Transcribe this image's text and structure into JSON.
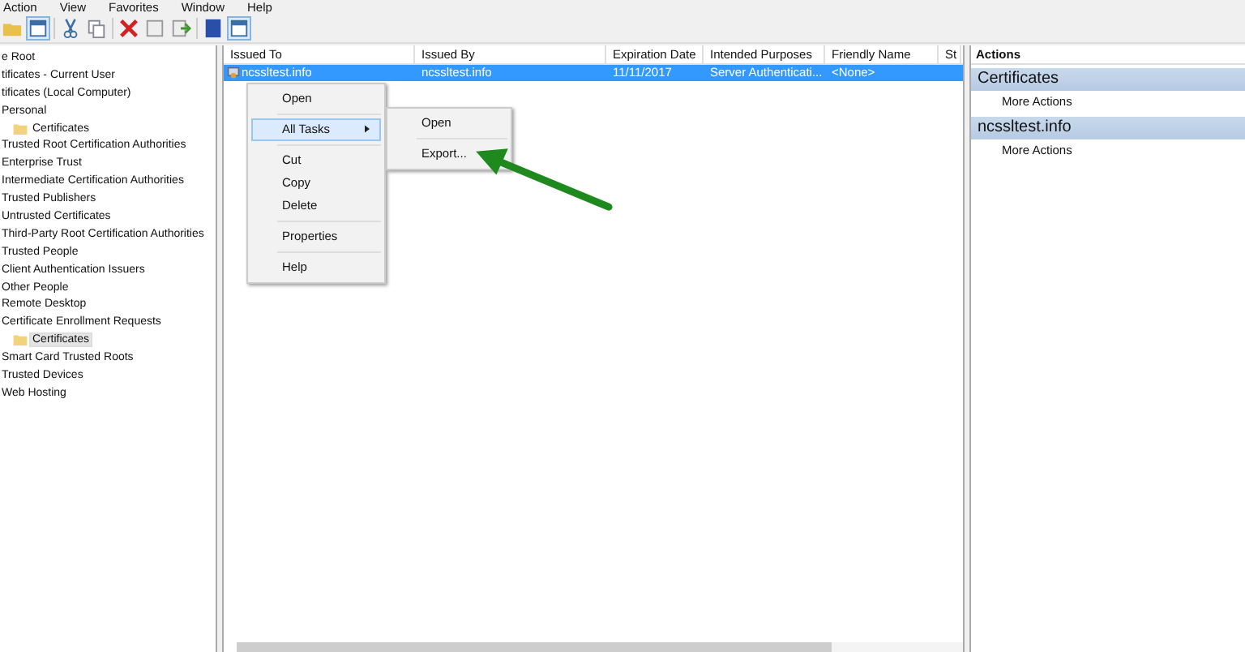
{
  "menu_bar": [
    "Action",
    "View",
    "Favorites",
    "Window",
    "Help"
  ],
  "tree": [
    {
      "label": "e Root",
      "selected": false
    },
    {
      "label": "tificates - Current User",
      "selected": false
    },
    {
      "label": "tificates (Local Computer)",
      "selected": false
    },
    {
      "label": "Personal",
      "selected": false,
      "children": [
        {
          "label": "Certificates",
          "selected": false
        }
      ]
    },
    {
      "label": "Trusted Root Certification Authorities",
      "selected": false
    },
    {
      "label": "Enterprise Trust",
      "selected": false
    },
    {
      "label": "Intermediate Certification Authorities",
      "selected": false
    },
    {
      "label": "Trusted Publishers",
      "selected": false
    },
    {
      "label": "Untrusted Certificates",
      "selected": false
    },
    {
      "label": "Third-Party Root Certification Authorities",
      "selected": false
    },
    {
      "label": "Trusted People",
      "selected": false
    },
    {
      "label": "Client Authentication Issuers",
      "selected": false
    },
    {
      "label": "Other People",
      "selected": false
    },
    {
      "label": "Remote Desktop",
      "selected": false
    },
    {
      "label": "Certificate Enrollment Requests",
      "selected": false,
      "children": [
        {
          "label": "Certificates",
          "selected": true
        }
      ]
    },
    {
      "label": "Smart Card Trusted Roots",
      "selected": false
    },
    {
      "label": "Trusted Devices",
      "selected": false
    },
    {
      "label": "Web Hosting",
      "selected": false
    }
  ],
  "table": {
    "columns": [
      "Issued To",
      "Issued By",
      "Expiration Date",
      "Intended Purposes",
      "Friendly Name",
      "St"
    ],
    "rows": [
      {
        "cells": [
          "ncssltest.info",
          "ncssltest.info",
          "11/11/2017",
          "Server Authenticati...",
          "<None>"
        ],
        "selected": true
      }
    ]
  },
  "context_menu": {
    "items": [
      {
        "label": "Open",
        "kind": "item",
        "selected": false
      },
      {
        "kind": "separator"
      },
      {
        "label": "All Tasks",
        "kind": "submenu",
        "selected": true
      },
      {
        "kind": "separator"
      },
      {
        "label": "Cut",
        "kind": "item",
        "selected": false
      },
      {
        "label": "Copy",
        "kind": "item",
        "selected": false
      },
      {
        "label": "Delete",
        "kind": "item",
        "selected": false
      },
      {
        "kind": "separator"
      },
      {
        "label": "Properties",
        "kind": "item",
        "selected": false
      },
      {
        "kind": "separator"
      },
      {
        "label": "Help",
        "kind": "item",
        "selected": false
      }
    ],
    "submenu": [
      {
        "label": "Open",
        "kind": "item",
        "selected": false
      },
      {
        "kind": "separator"
      },
      {
        "label": "Export...",
        "kind": "item",
        "selected": false
      }
    ]
  },
  "actions": {
    "title": "Actions",
    "sections": [
      {
        "heading": "Certificates",
        "items": [
          "More Actions"
        ]
      },
      {
        "heading": "ncssltest.info",
        "items": [
          "More Actions"
        ]
      }
    ]
  }
}
